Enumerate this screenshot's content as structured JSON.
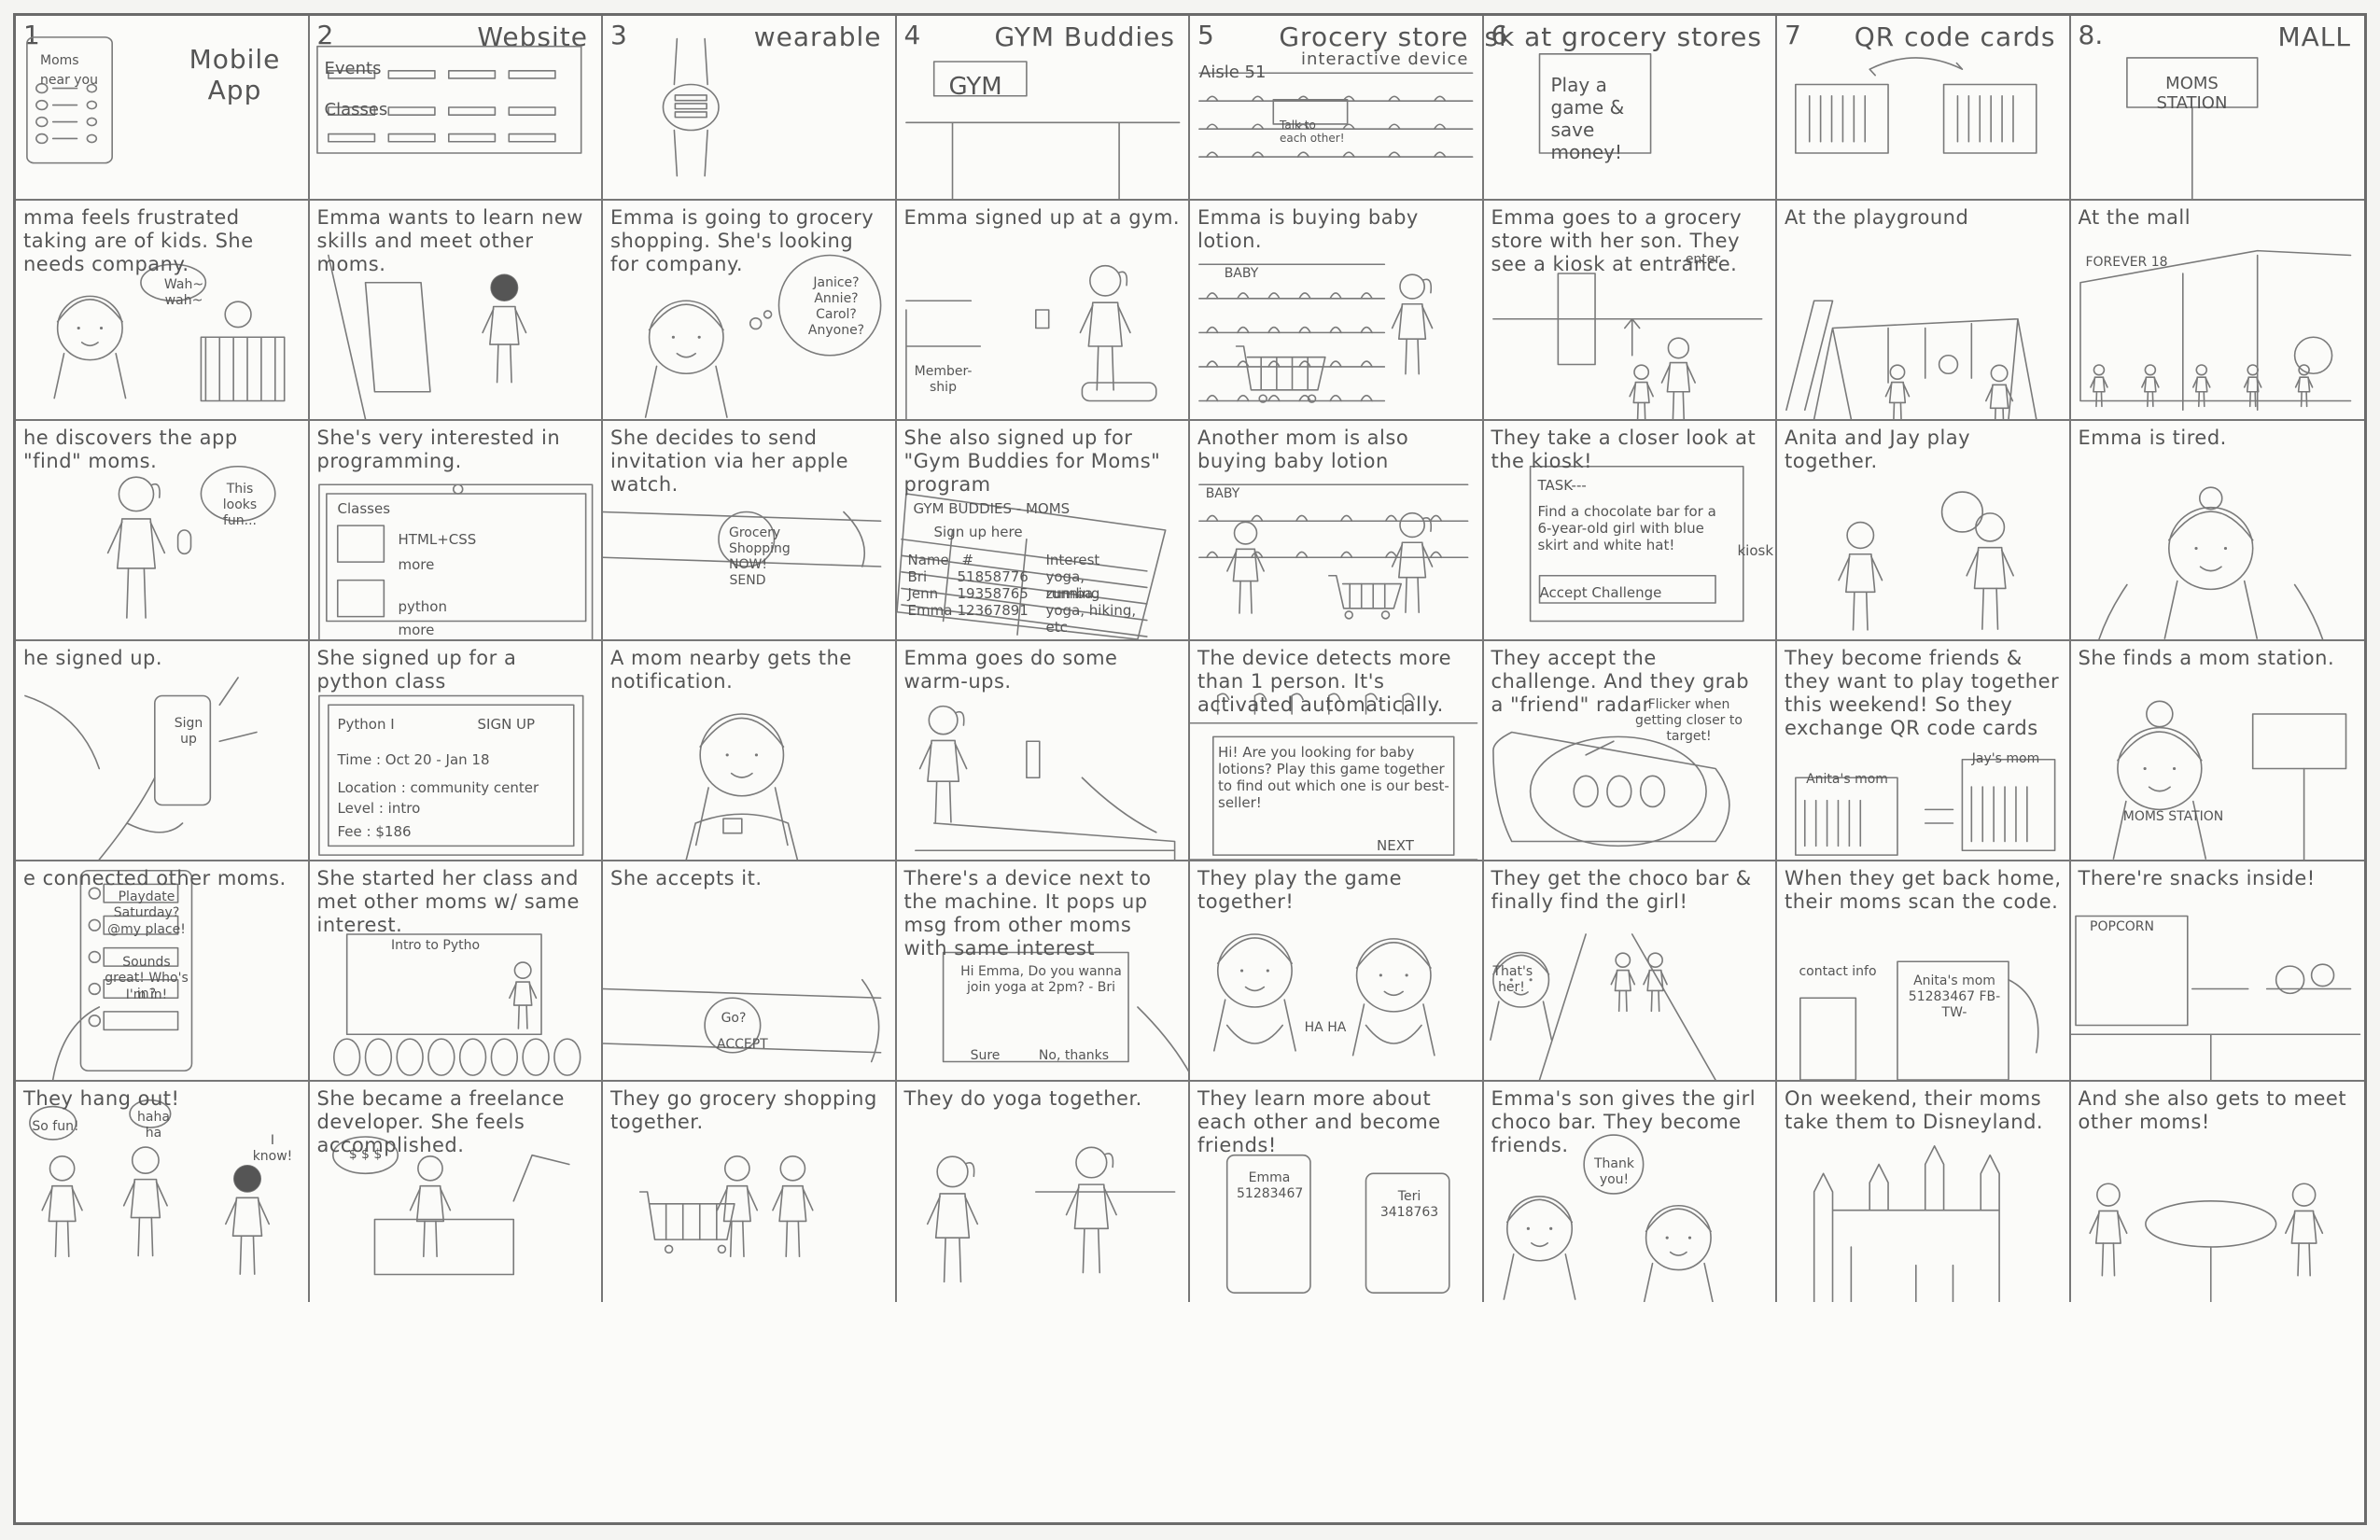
{
  "headers": [
    {
      "num": "1",
      "title": "Mobile App",
      "inner": [
        "Moms near you"
      ]
    },
    {
      "num": "2",
      "title": "Website",
      "inner": [
        "Events",
        "Classes"
      ]
    },
    {
      "num": "3",
      "title": "wearable",
      "inner": []
    },
    {
      "num": "4",
      "title": "GYM Buddies",
      "inner": [
        "GYM"
      ]
    },
    {
      "num": "5",
      "title": "Grocery store",
      "subtitle": "interactive device",
      "inner": [
        "Aisle 51",
        "Talk to each other!"
      ]
    },
    {
      "num": "6",
      "title": "Kiosk at grocery stores",
      "inner": [
        "Play a game & save money!"
      ]
    },
    {
      "num": "7",
      "title": "QR code cards",
      "inner": []
    },
    {
      "num": "8.",
      "title": "MALL",
      "inner": [
        "MOMS STATION"
      ]
    }
  ],
  "rows": [
    [
      {
        "caption": "mma feels frustrated taking are of kids. She needs company.",
        "bubbles": [
          "Wah~ wah~"
        ]
      },
      {
        "caption": "Emma wants to learn new skills and meet other moms.",
        "bubbles": []
      },
      {
        "caption": "Emma is going to grocery shopping. She's looking for company.",
        "bubbles": [
          "Janice? Annie? Carol? Anyone?"
        ]
      },
      {
        "caption": "Emma signed up at a gym.",
        "bubbles": [
          "Member-ship"
        ]
      },
      {
        "caption": "Emma is buying baby lotion.",
        "bubbles": [
          "BABY"
        ]
      },
      {
        "caption": "Emma goes to a grocery store with her son. They see a kiosk at entrance.",
        "bubbles": [
          "enter"
        ]
      },
      {
        "caption": "At the playground",
        "bubbles": []
      },
      {
        "caption": "At the mall",
        "bubbles": [
          "FOREVER 18"
        ]
      }
    ],
    [
      {
        "caption": "he discovers the app \"find\" moms.",
        "bubbles": [
          "This looks fun..."
        ]
      },
      {
        "caption": "She's very interested in programming.",
        "bubbles": [
          "Classes",
          "HTML+CSS",
          "more",
          "python",
          "more"
        ]
      },
      {
        "caption": "She decides to send invitation via her apple watch.",
        "bubbles": [
          "Grocery Shopping NOW! SEND"
        ]
      },
      {
        "caption": "She also signed up for \"Gym Buddies for Moms\" program",
        "bubbles": [
          "GYM BUDDIES - MOMS",
          "Sign up here",
          "Name",
          "#",
          "Interest",
          "Bri",
          "51858776",
          "yoga, running",
          "Jenn",
          "19358765",
          "zumba",
          "Emma",
          "12367891",
          "yoga, hiking, etc"
        ]
      },
      {
        "caption": "Another mom is also buying baby lotion",
        "bubbles": [
          "BABY"
        ]
      },
      {
        "caption": "They take a closer look at the kiosk!",
        "bubbles": [
          "TASK---",
          "Find a chocolate bar for a 6-year-old girl with blue skirt and white hat!",
          "Accept Challenge",
          "kiosk"
        ]
      },
      {
        "caption": "Anita and Jay play together.",
        "bubbles": []
      },
      {
        "caption": "Emma is tired.",
        "bubbles": []
      }
    ],
    [
      {
        "caption": "he signed up.",
        "bubbles": [
          "Sign up"
        ]
      },
      {
        "caption": "She signed up for a python class",
        "bubbles": [
          "Python I",
          "SIGN UP",
          "Time : Oct 20 - Jan 18",
          "Location : community center",
          "Level : intro",
          "Fee : $186"
        ]
      },
      {
        "caption": "A mom nearby gets the notification.",
        "bubbles": []
      },
      {
        "caption": "Emma goes do some warm-ups.",
        "bubbles": []
      },
      {
        "caption": "The device detects more than 1 person. It's activated automatically.",
        "bubbles": [
          "Hi! Are you looking for baby lotions? Play this game together to find out which one is our best-seller!",
          "NEXT"
        ]
      },
      {
        "caption": "They accept the challenge. And they grab a \"friend\" radar",
        "bubbles": [
          "Flicker when getting closer to target!"
        ]
      },
      {
        "caption": "They become friends & they want to play together this weekend! So they exchange QR code cards",
        "bubbles": [
          "Anita's mom",
          "Jay's mom"
        ]
      },
      {
        "caption": "She finds a mom station.",
        "bubbles": [
          "MOMS STATION"
        ]
      }
    ],
    [
      {
        "caption": "e connected other moms.",
        "bubbles": [
          "Playdate Saturday?",
          "@my place!",
          "Sounds great! Who's in?",
          "I'm in!"
        ]
      },
      {
        "caption": "She started her class and met other moms w/ same interest.",
        "bubbles": [
          "Intro to Pytho"
        ]
      },
      {
        "caption": "She accepts it.",
        "bubbles": [
          "Go?",
          "ACCEPT"
        ]
      },
      {
        "caption": "There's a device next to the machine. It pops up msg from other moms with same interest",
        "bubbles": [
          "Hi Emma, Do you wanna join yoga at 2pm? - Bri",
          "Sure",
          "No, thanks"
        ]
      },
      {
        "caption": "They play the game together!",
        "bubbles": [
          "HA HA"
        ]
      },
      {
        "caption": "They get the choco bar & finally find the girl!",
        "bubbles": [
          "That's her!"
        ]
      },
      {
        "caption": "When they get back home, their moms scan the code.",
        "bubbles": [
          "contact info",
          "Anita's mom 51283467 FB- TW-"
        ]
      },
      {
        "caption": "There're snacks inside!",
        "bubbles": [
          "POPCORN"
        ]
      }
    ],
    [
      {
        "caption": "They hang out!",
        "bubbles": [
          "So fun!",
          "haha ha",
          "I know!"
        ]
      },
      {
        "caption": "She became a freelance developer. She feels accomplished.",
        "bubbles": [
          "$ $ $"
        ]
      },
      {
        "caption": "They go grocery shopping together.",
        "bubbles": []
      },
      {
        "caption": "They do yoga together.",
        "bubbles": []
      },
      {
        "caption": "They learn more about each other and become friends!",
        "bubbles": [
          "Emma 51283467",
          "Teri 3418763"
        ]
      },
      {
        "caption": "Emma's son gives the girl choco bar. They become friends.",
        "bubbles": [
          "Thank you!"
        ]
      },
      {
        "caption": "On weekend, their moms take them to Disneyland.",
        "bubbles": []
      },
      {
        "caption": "And she also gets to meet other moms!",
        "bubbles": []
      }
    ]
  ]
}
